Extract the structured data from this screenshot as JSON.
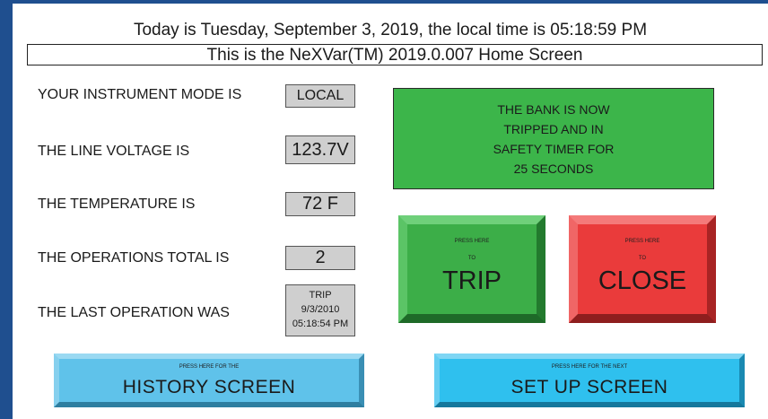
{
  "header": {
    "date_line": "Today is Tuesday, September 3, 2019, the local time is 05:18:59 PM",
    "home_line": "This is the NeXVar(TM) 2019.0.007 Home Screen"
  },
  "readouts": {
    "mode_label": "YOUR INSTRUMENT MODE IS",
    "mode_value": "LOCAL",
    "voltage_label": "THE LINE VOLTAGE IS",
    "voltage_value": "123.7V",
    "temperature_label": "THE TEMPERATURE IS",
    "temperature_value": "72 F",
    "operations_label": "THE OPERATIONS TOTAL IS",
    "operations_value": "2",
    "last_op_label": "THE LAST OPERATION WAS",
    "last_op_type": "TRIP",
    "last_op_date": "9/3/2010",
    "last_op_time": "05:18:54 PM"
  },
  "status": {
    "line1": "THE BANK IS NOW",
    "line2": "TRIPPED AND IN",
    "line3": "SAFETY TIMER FOR",
    "line4": "25 SECONDS"
  },
  "trip_button": {
    "hint1": "PRESS HERE",
    "hint2": "TO",
    "label": "TRIP"
  },
  "close_button": {
    "hint1": "PRESS HERE",
    "hint2": "TO",
    "label": "CLOSE"
  },
  "history_button": {
    "hint": "PRESS HERE FOR THE",
    "label": "HISTORY SCREEN"
  },
  "setup_button": {
    "hint": "PRESS HERE FOR THE NEXT",
    "label": "SET UP SCREEN"
  },
  "colors": {
    "background": "#1f4f8f",
    "status_green": "#3cb54a",
    "trip_green": "#3cae48",
    "close_red": "#ea3b3b",
    "history_blue": "#5fc2ea",
    "setup_blue": "#2fc0ee",
    "value_gray": "#cfcfcf"
  }
}
